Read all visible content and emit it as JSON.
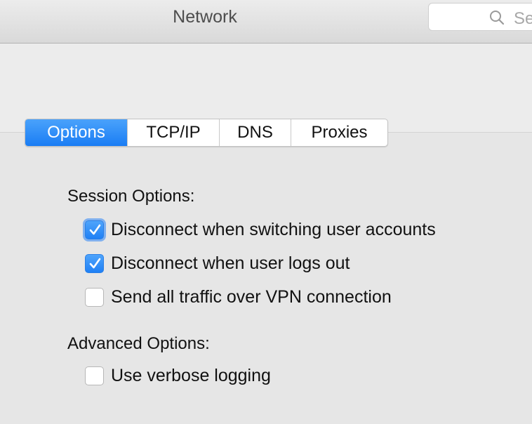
{
  "window": {
    "title": "Network"
  },
  "search": {
    "placeholder": "Se"
  },
  "tabs": [
    {
      "label": "Options",
      "active": true
    },
    {
      "label": "TCP/IP",
      "active": false
    },
    {
      "label": "DNS",
      "active": false
    },
    {
      "label": "Proxies",
      "active": false
    }
  ],
  "session_options": {
    "title": "Session Options:",
    "items": [
      {
        "label": "Disconnect when switching user accounts",
        "checked": true,
        "focused": true
      },
      {
        "label": "Disconnect when user logs out",
        "checked": true,
        "focused": false
      },
      {
        "label": "Send all traffic over VPN connection",
        "checked": false,
        "focused": false
      }
    ]
  },
  "advanced_options": {
    "title": "Advanced Options:",
    "items": [
      {
        "label": "Use verbose logging",
        "checked": false,
        "focused": false
      }
    ]
  },
  "colors": {
    "accent": "#1a7df4",
    "background": "#ececec",
    "panel": "#e6e6e6"
  }
}
